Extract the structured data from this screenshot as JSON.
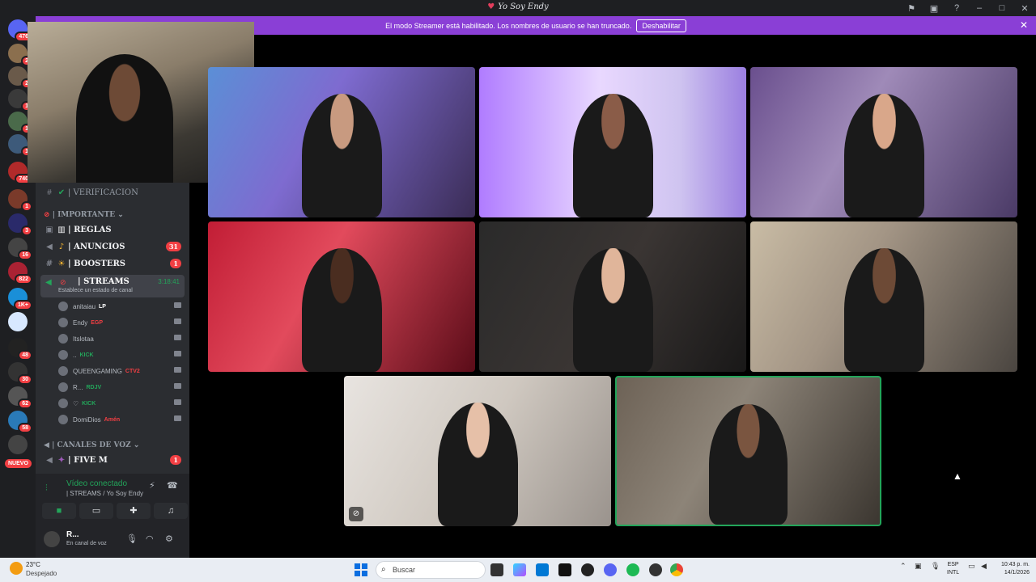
{
  "window": {
    "title": "Yo Soy Endy",
    "controls": [
      "pin-icon",
      "inbox-icon",
      "help-icon",
      "minimize-icon",
      "maximize-icon",
      "close-icon"
    ]
  },
  "banner": {
    "text": "El modo Streamer está habilitado. Los nombres de usuario se han truncado.",
    "button": "Deshabilitar"
  },
  "servers": [
    {
      "badge": "476"
    },
    {
      "badge": "2"
    },
    {
      "badge": "2"
    },
    {
      "badge": "1"
    },
    {
      "badge": "1"
    },
    {
      "badge": "1"
    },
    {
      "badge": "740"
    },
    {
      "badge": "1"
    },
    {
      "badge": "3"
    },
    {
      "badge": "16"
    },
    {
      "badge": "822"
    },
    {
      "badge": "1K+"
    },
    {
      "badge": ""
    },
    {
      "badge": "48"
    },
    {
      "badge": "30"
    },
    {
      "badge": "62"
    },
    {
      "badge": "58"
    },
    {
      "badge": ""
    }
  ],
  "rail_new_label": "NUEVO",
  "sidebar": {
    "verificacion": "| VERIFICACION",
    "cat_importante": "| IMPORTANTE",
    "channels": [
      {
        "name": "| REGLAS",
        "badge": ""
      },
      {
        "name": "| ANUNCIOS",
        "badge": "31"
      },
      {
        "name": "| BOOSTERS",
        "badge": "1"
      }
    ],
    "streams": {
      "name": "| STREAMS",
      "status": "Establece un estado de canal",
      "time": "3:18:41"
    },
    "users": [
      {
        "name": "anitaiau",
        "tag": "LP"
      },
      {
        "name": "Endy",
        "tag": "EGP"
      },
      {
        "name": "Itslotaa",
        "tag": ""
      },
      {
        "name": "..",
        "tag": "KICK"
      },
      {
        "name": "QUEENGAMING",
        "tag": "CTV2"
      },
      {
        "name": "R...",
        "tag": "RDJV"
      },
      {
        "name": "♡",
        "tag": "KICK"
      },
      {
        "name": "DomiDios",
        "tag": "Amén"
      }
    ],
    "cat_voz": "| CANALES DE VOZ",
    "five_m": {
      "name": "| FIVE M",
      "badge": "1"
    }
  },
  "voice": {
    "status": "Vídeo conectado",
    "channel": "| STREAMS / Yo Soy Endy",
    "user_name": "R...",
    "user_status": "En canal de voz"
  },
  "tiles": [
    {
      "id": "t1",
      "face": "#c89a80"
    },
    {
      "id": "t2",
      "face": "#8a5c48"
    },
    {
      "id": "t3",
      "face": "#d9a78a"
    },
    {
      "id": "t4",
      "face": "#4a2d20"
    },
    {
      "id": "t5",
      "face": "#e0b59a"
    },
    {
      "id": "t6",
      "face": "#6d4a36"
    },
    {
      "id": "t7",
      "face": "#e6c0a8"
    },
    {
      "id": "t8",
      "face": "#7a5540"
    }
  ],
  "taskbar": {
    "temp": "23°C",
    "weather": "Despejado",
    "search": "Buscar",
    "lang_1": "ESP",
    "lang_2": "INTL",
    "time": "10:43 p. m.",
    "date": "14/1/2026"
  }
}
